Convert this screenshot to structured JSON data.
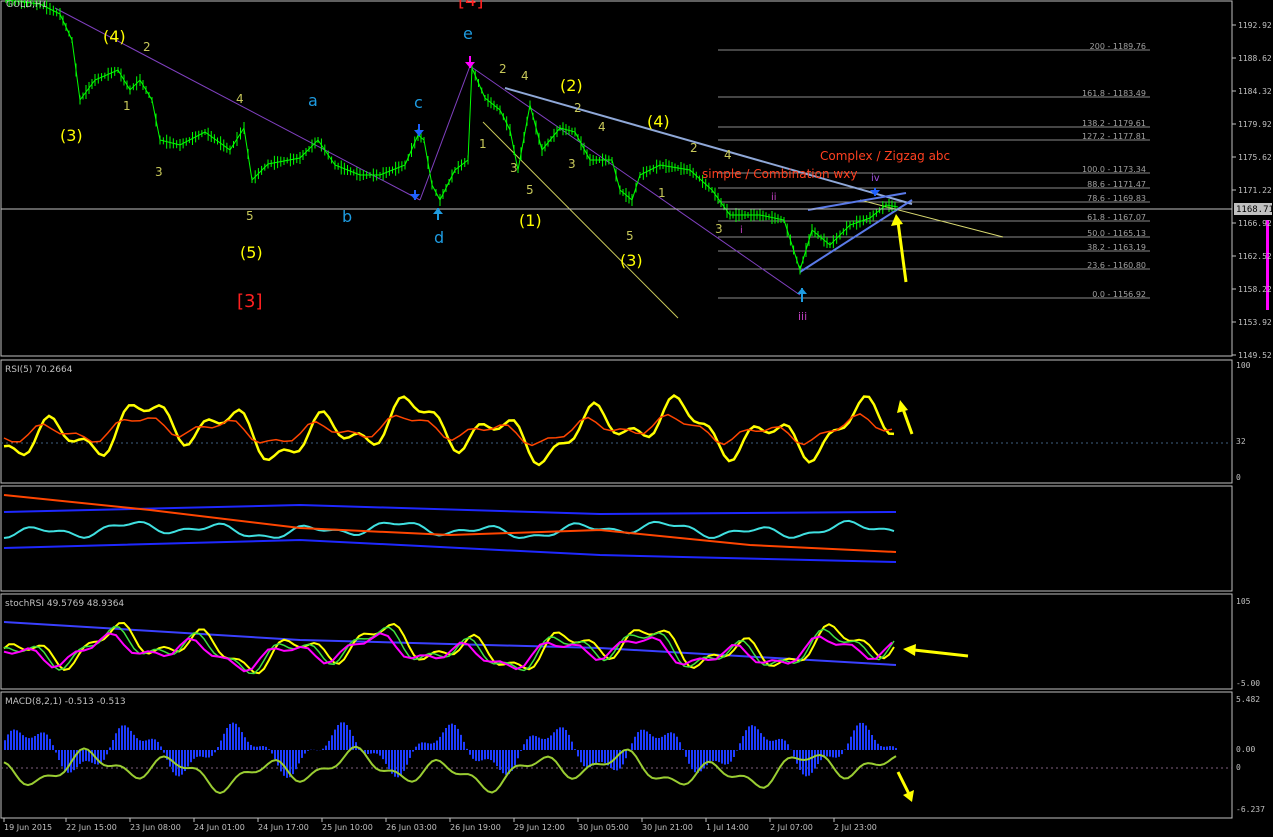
{
  "main": {
    "symbol_label": "GOLD,H1",
    "current_price": "1168.71",
    "price_ticks": [
      "1192.92",
      "1188.62",
      "1184.32",
      "1179.92",
      "1175.62",
      "1171.22",
      "1166.92",
      "1162.52",
      "1158.22",
      "1153.92",
      "1149.52"
    ],
    "fib_levels": [
      "200 - 1189.76",
      "161.8 - 1183.49",
      "138.2 - 1179.61",
      "127.2 - 1177.81",
      "100.0 - 1173.34",
      "88.6 - 1171.47",
      "78.6 - 1169.83",
      "61.8 - 1167.07",
      "50.0 - 1165.13",
      "38.2 - 1163.19",
      "23.6 - 1160.80",
      "0.0 - 1156.92"
    ],
    "annotation_complex": "Complex / Zigzag abc",
    "annotation_simple": "simple / Combination wxy",
    "wave_labels": {
      "w4_top": "(4)",
      "w2_top": "2",
      "w3_paren": "(3)",
      "w1_a": "1",
      "w4_a": "4",
      "w3_a": "3",
      "w5_a": "5",
      "w5_paren": "(5)",
      "w3_bracket": "[3]",
      "a": "a",
      "b": "b",
      "c": "c",
      "d": "d",
      "e": "e",
      "w4_bracket": "[4]",
      "w2_b": "2",
      "w4_b": "4",
      "w1_b": "1",
      "w3_b": "3",
      "w5_b": "5",
      "w1_paren": "(1)",
      "w2_paren": "(2)",
      "w2_c": "2",
      "w3_c": "3",
      "w4_c": "4",
      "w5_c": "5",
      "w3_paren_b": "(3)",
      "w4_paren": "(4)",
      "w2_d": "2",
      "w1_d": "1",
      "w4_d": "4",
      "w3_d": "3",
      "i": "i",
      "ii": "ii",
      "iii": "iii",
      "iv": "iv"
    }
  },
  "rsi": {
    "label": "RSI(5) 70.2664",
    "ticks": [
      "100",
      "32",
      "0"
    ]
  },
  "panel3": {
    "label": ""
  },
  "stochrsi": {
    "label": "stochRSI 49.5769 48.9364",
    "ticks": [
      "105",
      "-5.00"
    ]
  },
  "macd": {
    "label": "MACD(8,2,1) -0.513 -0.513",
    "ticks": [
      "5.482",
      "0.00",
      "0",
      "-6.237"
    ]
  },
  "time_axis": [
    "19 Jun 2015",
    "22 Jun 15:00",
    "23 Jun 08:00",
    "24 Jun 01:00",
    "24 Jun 17:00",
    "25 Jun 10:00",
    "26 Jun 03:00",
    "26 Jun 19:00",
    "29 Jun 12:00",
    "30 Jun 05:00",
    "30 Jun 21:00",
    "1 Jul 14:00",
    "2 Jul 07:00",
    "2 Jul 23:00"
  ],
  "colors": {
    "background": "#000000",
    "candle": "#00ff00",
    "panel_border": "#c0c0c0",
    "wave_yellow": "#ffff00",
    "wave_blue": "#1e9be0",
    "wave_red": "#ff2020",
    "wave_olive": "#c8c85a",
    "fib_line": "#8a8a8a",
    "trend_blue": "#8fa8d8",
    "rsi_yellow": "#ffff00",
    "rsi_ma": "#ff4500",
    "macd_hist": "#1e3cff",
    "macd_line": "#9acd32",
    "cyan_line": "#40e0e0",
    "magenta": "#ff00ff"
  }
}
